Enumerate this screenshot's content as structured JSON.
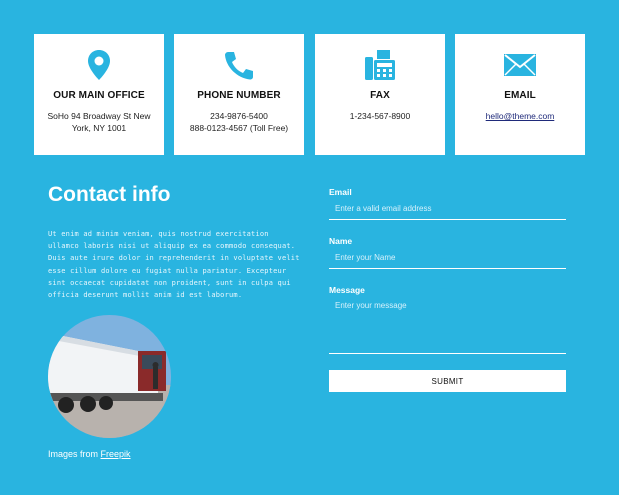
{
  "cards": [
    {
      "icon": "location-pin-icon",
      "title": "OUR MAIN OFFICE",
      "line1": "SoHo 94 Broadway St New",
      "line2": "York, NY 1001"
    },
    {
      "icon": "phone-icon",
      "title": "PHONE NUMBER",
      "line1": "234-9876-5400",
      "line2": "888-0123-4567 (Toll Free)"
    },
    {
      "icon": "fax-icon",
      "title": "FAX",
      "line1": "1-234-567-8900",
      "line2": ""
    },
    {
      "icon": "envelope-icon",
      "title": "EMAIL",
      "line1": "hello@theme.com",
      "line2": ""
    }
  ],
  "contact": {
    "title": "Contact info",
    "paragraph": "Ut enim ad minim veniam, quis nostrud exercitation ullamco laboris nisi ut aliquip ex ea commodo consequat. Duis aute irure dolor in reprehenderit in voluptate velit esse cillum dolore eu fugiat nulla pariatur. Excepteur sint occaecat cupidatat non proident, sunt in culpa qui officia deserunt mollit anim id est laborum.",
    "credit_prefix": "Images from",
    "credit_link": "Freepik"
  },
  "form": {
    "email_label": "Email",
    "email_placeholder": "Enter a valid email address",
    "name_label": "Name",
    "name_placeholder": "Enter your Name",
    "message_label": "Message",
    "message_placeholder": "Enter your message",
    "submit_label": "SUBMIT"
  },
  "colors": {
    "background": "#29b4e0",
    "icon_accent": "#29b4e0",
    "card": "#ffffff"
  }
}
